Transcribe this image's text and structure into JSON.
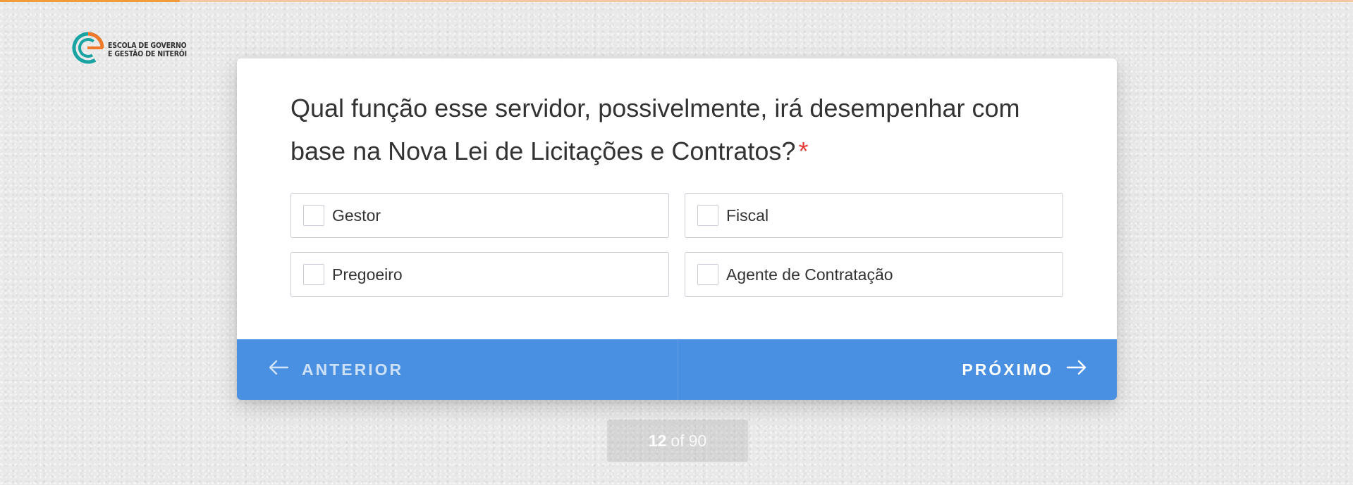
{
  "progress": {
    "fraction": 0.133,
    "color": "#f39a3d"
  },
  "logo": {
    "icon": "escola-de-governo-logo-icon",
    "line1": "ESCOLA DE GOVERNO",
    "line2": "E GESTÃO DE NITERÓI"
  },
  "question": {
    "text": "Qual função esse servidor, possivelmente, irá desempenhar com base na Nova Lei de Licitações e Contratos?",
    "required_marker": "*"
  },
  "options": [
    {
      "label": "Gestor",
      "checked": false
    },
    {
      "label": "Fiscal",
      "checked": false
    },
    {
      "label": "Pregoeiro",
      "checked": false
    },
    {
      "label": "Agente de Contratação",
      "checked": false
    }
  ],
  "nav": {
    "prev_label": "ANTERIOR",
    "next_label": "PRÓXIMO",
    "prev_icon": "arrow-left-icon",
    "next_icon": "arrow-right-icon",
    "color": "#4a90e2"
  },
  "counter": {
    "current": "12",
    "separator": "of",
    "total": "90"
  }
}
